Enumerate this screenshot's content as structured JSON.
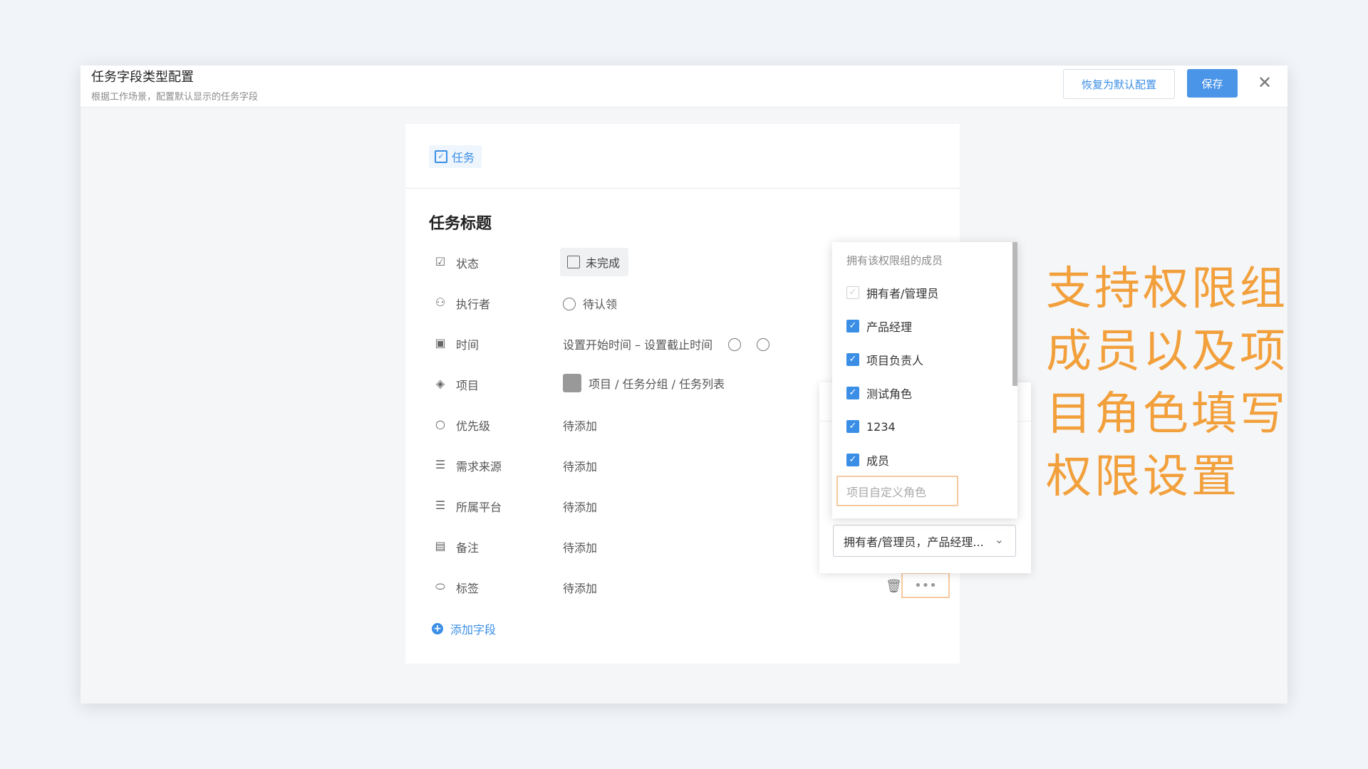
{
  "header": {
    "title": "任务字段类型配置",
    "subtitle": "根据工作场景，配置默认显示的任务字段",
    "restore_label": "恢复为默认配置",
    "save_label": "保存"
  },
  "card": {
    "tag_label": "任务",
    "title": "任务标题",
    "fields": [
      {
        "name": "状态",
        "icon": "checkbox-icon",
        "value": "未完成"
      },
      {
        "name": "执行者",
        "icon": "user-icon",
        "value": "待认领"
      },
      {
        "name": "时间",
        "icon": "calendar-icon",
        "value": "设置开始时间 – 设置截止时间"
      },
      {
        "name": "项目",
        "icon": "layers-icon",
        "value": "项目 / 任务分组 / 任务列表"
      },
      {
        "name": "优先级",
        "icon": "circle-icon",
        "value": "待添加"
      },
      {
        "name": "需求来源",
        "icon": "list-icon",
        "value": "待添加"
      },
      {
        "name": "所属平台",
        "icon": "list-icon",
        "value": "待添加"
      },
      {
        "name": "备注",
        "icon": "note-icon",
        "value": "待添加"
      },
      {
        "name": "标签",
        "icon": "tag-icon",
        "value": "待添加"
      }
    ],
    "add_field_label": "添加字段"
  },
  "permission": {
    "dropdown_header": "拥有该权限组的成员",
    "options": [
      {
        "label": "拥有者/管理员",
        "checked": true,
        "disabled": true
      },
      {
        "label": "产品经理",
        "checked": true
      },
      {
        "label": "项目负责人",
        "checked": true
      },
      {
        "label": "测试角色",
        "checked": true
      },
      {
        "label": "1234",
        "checked": true
      },
      {
        "label": "成员",
        "checked": true
      }
    ],
    "custom_role_placeholder": "项目自定义角色",
    "selected_value": "拥有者/管理员，产品经理..."
  },
  "annotation": {
    "line1": "支持权限组",
    "line2": "成员以及项",
    "line3": "目角色填写",
    "line4": "权限设置"
  },
  "colors": {
    "accent": "#3a8ee6",
    "annotation": "#f2a03c",
    "highlight_border": "#f7c9a0"
  }
}
